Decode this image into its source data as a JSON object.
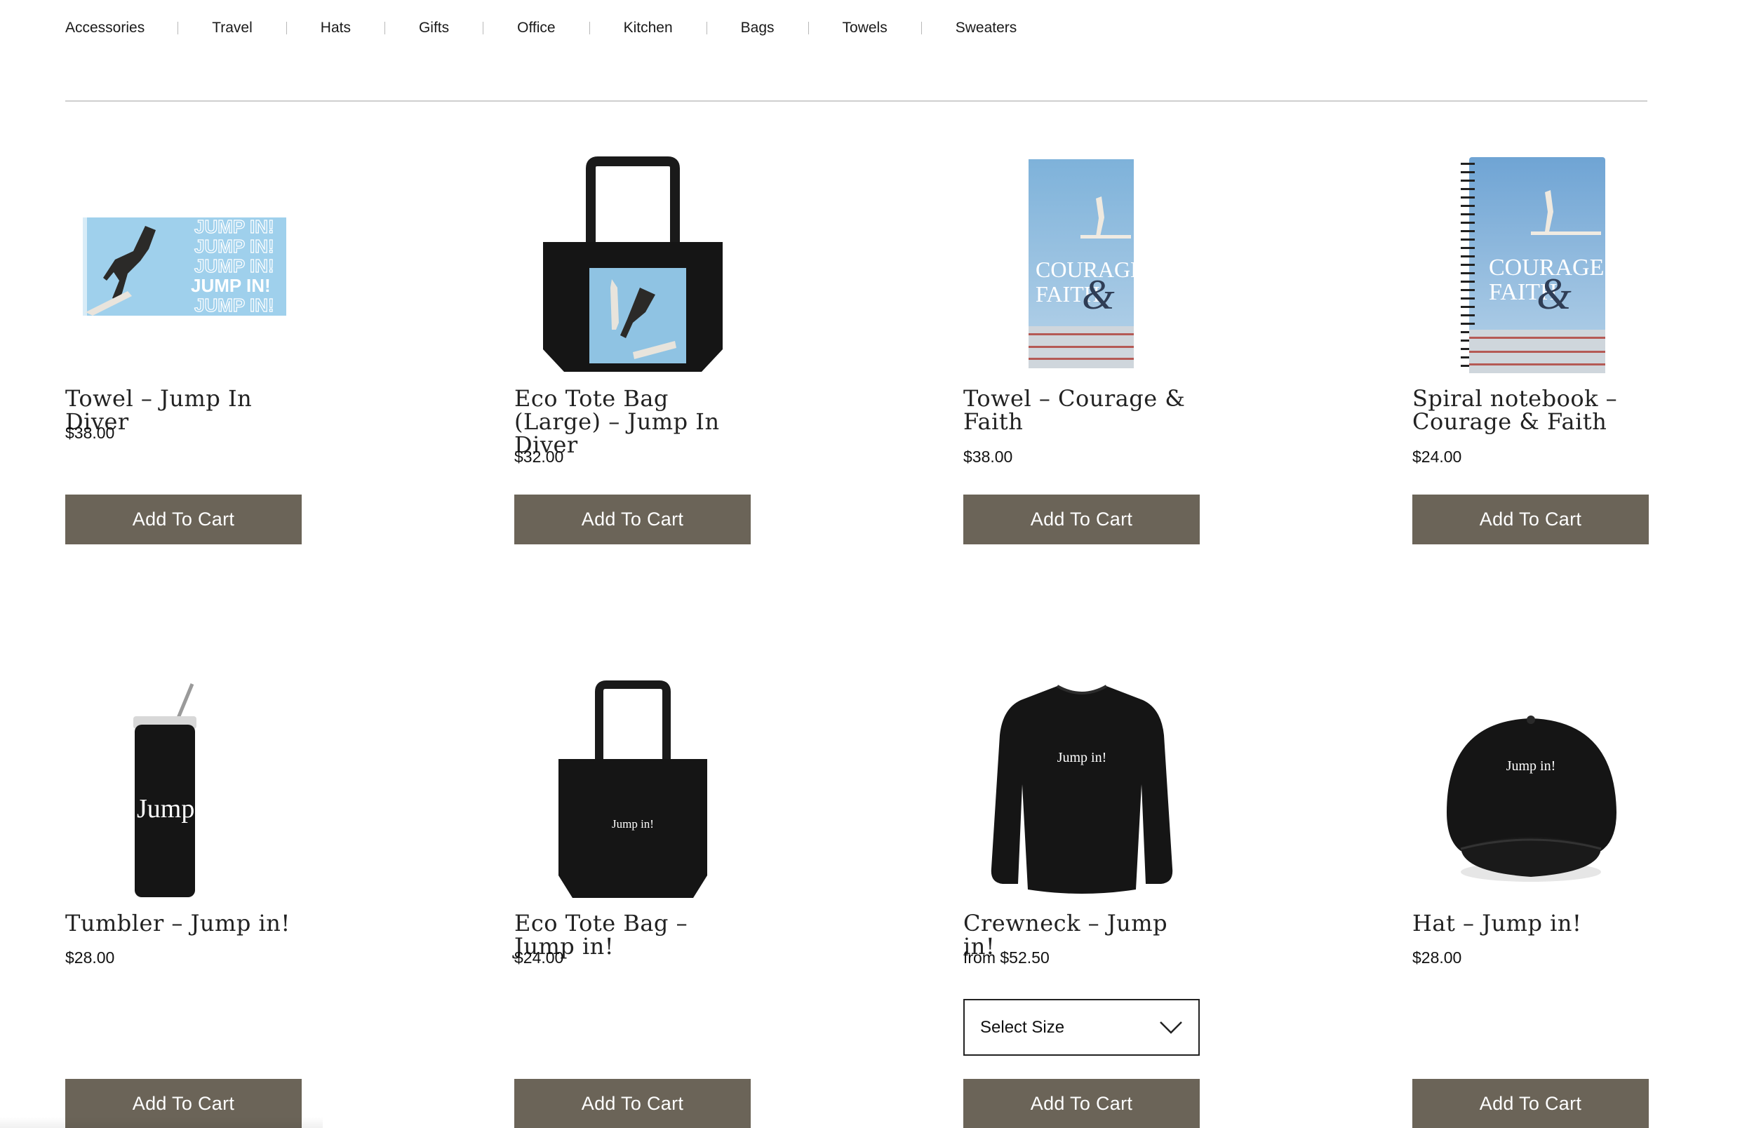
{
  "nav": {
    "categories": [
      "Accessories",
      "Travel",
      "Hats",
      "Gifts",
      "Office",
      "Kitchen",
      "Bags",
      "Towels",
      "Sweaters"
    ]
  },
  "products": [
    {
      "title": "Towel – Jump In Diver",
      "price": "$38.00",
      "button": "Add To Cart",
      "image": "towel-jump-in-diver-image"
    },
    {
      "title": "Eco Tote Bag (Large) – Jump In Diver",
      "price": "$32.00",
      "button": "Add To Cart",
      "image": "tote-large-diver-image"
    },
    {
      "title": "Towel – Courage & Faith",
      "price": "$38.00",
      "button": "Add To Cart",
      "image": "towel-courage-faith-image"
    },
    {
      "title": "Spiral notebook – Courage & Faith",
      "price": "$24.00",
      "button": "Add To Cart",
      "image": "notebook-courage-faith-image"
    },
    {
      "title": "Tumbler – Jump in!",
      "price": "$28.00",
      "button": "Add To Cart",
      "image": "tumbler-image",
      "print": "Jump in"
    },
    {
      "title": "Eco Tote Bag – Jump in!",
      "price": "$24.00",
      "button": "Add To Cart",
      "image": "tote-image",
      "print": "Jump in!"
    },
    {
      "title": "Crewneck – Jump in!",
      "price": "from $52.50",
      "button": "Add To Cart",
      "select": "Select Size",
      "image": "crewneck-image",
      "print": "Jump in!"
    },
    {
      "title": "Hat – Jump in!",
      "price": "$28.00",
      "button": "Add To Cart",
      "image": "hat-image",
      "print": "Jump in!"
    }
  ],
  "art": {
    "towel_words": [
      "JUMP IN!",
      "JUMP IN!",
      "JUMP IN!",
      "JUMP IN!",
      "JUMP IN!"
    ],
    "courage": "COURAGE",
    "faith": "FAITH",
    "amp": "&"
  },
  "colors": {
    "button": "#6b6458",
    "sky": "#8fc3e3",
    "black_merch": "#151515"
  }
}
